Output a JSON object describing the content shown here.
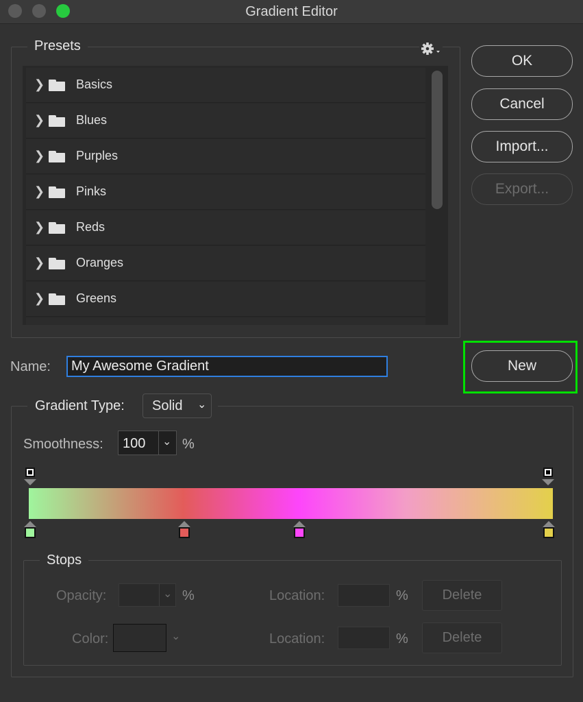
{
  "window": {
    "title": "Gradient Editor"
  },
  "presets": {
    "label": "Presets",
    "items": [
      {
        "label": "Basics"
      },
      {
        "label": "Blues"
      },
      {
        "label": "Purples"
      },
      {
        "label": "Pinks"
      },
      {
        "label": "Reds"
      },
      {
        "label": "Oranges"
      },
      {
        "label": "Greens"
      }
    ]
  },
  "buttons": {
    "ok": "OK",
    "cancel": "Cancel",
    "import": "Import...",
    "export": "Export...",
    "new": "New"
  },
  "name": {
    "label": "Name:",
    "value": "My Awesome Gradient"
  },
  "gradient": {
    "type_label": "Gradient Type:",
    "type_value": "Solid",
    "smoothness_label": "Smoothness:",
    "smoothness_value": "100",
    "smoothness_unit": "%",
    "color_stops": [
      "#9ff59d",
      "#e35c5a",
      "#fd45fb",
      "#e3d04b"
    ]
  },
  "stops": {
    "label": "Stops",
    "opacity_label": "Opacity:",
    "color_label": "Color:",
    "location_label": "Location:",
    "percent": "%",
    "delete_label": "Delete"
  },
  "colors": {
    "highlight": "#00e000",
    "input_focus": "#2f7fe0",
    "traffic_close": "#5a5a5a",
    "traffic_max": "#27c93f"
  }
}
